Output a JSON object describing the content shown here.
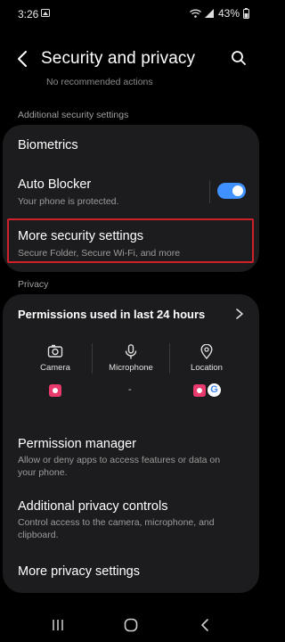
{
  "status": {
    "time": "3:26",
    "battery": "43%"
  },
  "header": {
    "title": "Security and privacy"
  },
  "faded_text": "No recommended actions",
  "sections": {
    "additional_security": "Additional security settings",
    "privacy": "Privacy"
  },
  "security_items": {
    "biometrics": "Biometrics",
    "auto_blocker": {
      "title": "Auto Blocker",
      "subtitle": "Your phone is protected.",
      "enabled": true
    },
    "more_security": {
      "title": "More security settings",
      "subtitle": "Secure Folder, Secure Wi-Fi, and more"
    }
  },
  "permissions": {
    "title": "Permissions used in last 24 hours",
    "camera": {
      "label": "Camera"
    },
    "microphone": {
      "label": "Microphone",
      "value": "-"
    },
    "location": {
      "label": "Location"
    }
  },
  "privacy_items": {
    "permission_manager": {
      "title": "Permission manager",
      "subtitle": "Allow or deny apps to access features or data on your phone."
    },
    "additional_privacy": {
      "title": "Additional privacy controls",
      "subtitle": "Control access to the camera, microphone, and clipboard."
    },
    "more_privacy": {
      "title": "More privacy settings"
    }
  },
  "colors": {
    "accent": "#3e91ff",
    "highlight": "#d0212a",
    "card": "#1c1c1e"
  }
}
